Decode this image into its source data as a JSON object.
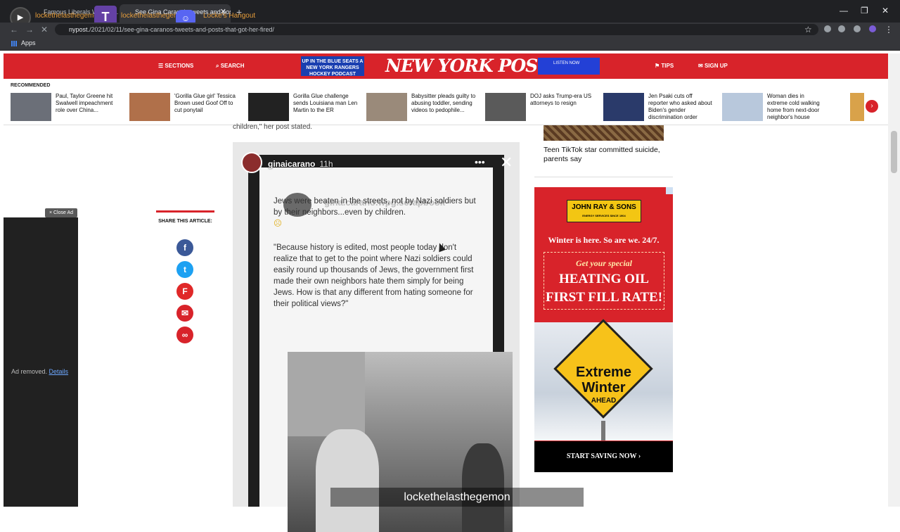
{
  "browser": {
    "tabs": [
      {
        "title": "Famous Liberals Who've..."
      },
      {
        "title": "See Gina Carano's tweets and posts..."
      }
    ],
    "url_host": "nypost.",
    "url_path": "/2021/02/11/see-gina-caranos-tweets-and-posts-that-got-her-fired/",
    "bookmark": "Apps"
  },
  "stream_overlay": {
    "twitch_name": "lockethelasthegemon",
    "twitch_name2": "lockethelasthegemon",
    "discord_label": "Locke's Hangout",
    "caption": "lockethelasthegemon"
  },
  "header": {
    "sections": "SECTIONS",
    "search": "SEARCH",
    "logo": "NEW YORK POST",
    "ad_left": "UP IN THE BLUE SEATS A NEW YORK RANGERS HOCKEY PODCAST",
    "ad_right": "LISTEN NOW",
    "tips": "TIPS",
    "signup": "SIGN UP"
  },
  "recommended": {
    "label": "RECOMMENDED",
    "items": [
      {
        "text": "Paul, Taylor Greene hit Swalwell impeachment role over China..."
      },
      {
        "text": "'Gorilla Glue girl' Tessica Brown used Goof Off to cut ponytail"
      },
      {
        "text": "Gorilla Glue challenge sends Louisiana man Len Martin to the ER"
      },
      {
        "text": "Babysitter pleads guilty to abusing toddler, sending videos to pedophile..."
      },
      {
        "text": "DOJ asks Trump-era US attorneys to resign"
      },
      {
        "text": "Jen Psaki cuts off reporter who asked about Biden's gender discrimination order"
      },
      {
        "text": "Woman dies in extreme cold walking home from next-door neighbor's house"
      }
    ]
  },
  "left_ad": {
    "close": "× Close Ad",
    "removed": "Ad removed.",
    "details": "Details"
  },
  "share": {
    "label": "SHARE THIS ARTICLE:"
  },
  "article": {
    "caption_top": "children,\" her post stated.",
    "story_user": "ginaicarano",
    "story_time": "11h",
    "inner_user": "gina.carano.wpg.scrapbook",
    "paragraph1": "Jews were beaten in the streets, not by Nazi soldiers but by their neighbors...even by children.",
    "paragraph2": "\"Because history is edited, most people today don't realize that to get to the point where Nazi soldiers could easily round up thousands of Jews, the government first made their own neighbors hate them simply for being Jews. How is that any different from hating someone for their political views?\""
  },
  "rail": {
    "card_title": "Teen TikTok star committed suicide, parents say"
  },
  "ad_right": {
    "brand": "JOHN RAY & SONS",
    "brand_sub": "ENERGY SERVICES SINCE 1904",
    "line1": "Winter is here. So are we. 24/7.",
    "special": "Get your special",
    "big1": "HEATING OIL",
    "big2": "FIRST FILL RATE!",
    "sign1": "Extreme",
    "sign2": "Winter",
    "sign3": "AHEAD",
    "cta": "START SAVING NOW ›"
  }
}
